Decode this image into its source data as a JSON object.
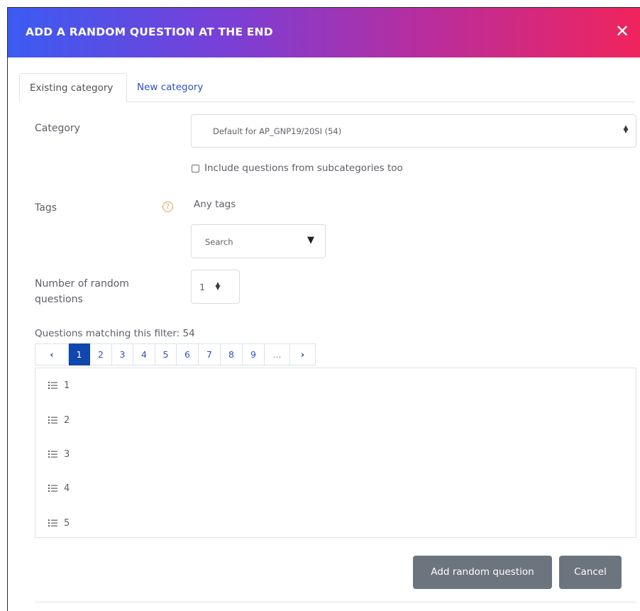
{
  "modal": {
    "title": "ADD A RANDOM QUESTION AT THE END",
    "close_glyph": "✕"
  },
  "tabs": [
    {
      "label": "Existing category",
      "active": true
    },
    {
      "label": "New category",
      "active": false
    }
  ],
  "form": {
    "category_label": "Category",
    "category_value": "Default for AP_GNP19/20SI (54)",
    "include_subcategories_label": "Include questions from subcategories too",
    "include_subcategories_checked": false,
    "tags_label": "Tags",
    "tags_help_glyph": "?",
    "tags_value": "Any tags",
    "tags_search_placeholder": "Search",
    "tags_dropdown_glyph": "▼",
    "number_label": "Number of random questions",
    "number_value": "1"
  },
  "filter": {
    "matching_text": "Questions matching this filter: 54"
  },
  "pagination": {
    "prev": "‹",
    "next": "›",
    "pages": [
      "1",
      "2",
      "3",
      "4",
      "5",
      "6",
      "7",
      "8",
      "9",
      "..."
    ],
    "current": "1"
  },
  "questions": [
    "1",
    "2",
    "3",
    "4",
    "5"
  ],
  "buttons": {
    "add": "Add random question",
    "cancel": "Cancel"
  },
  "colors": {
    "header_gradient_start": "#3b5bf2",
    "header_gradient_end": "#f0245c",
    "link": "#2b50c4",
    "active_page": "#0f47ad",
    "button": "#6c757d"
  }
}
